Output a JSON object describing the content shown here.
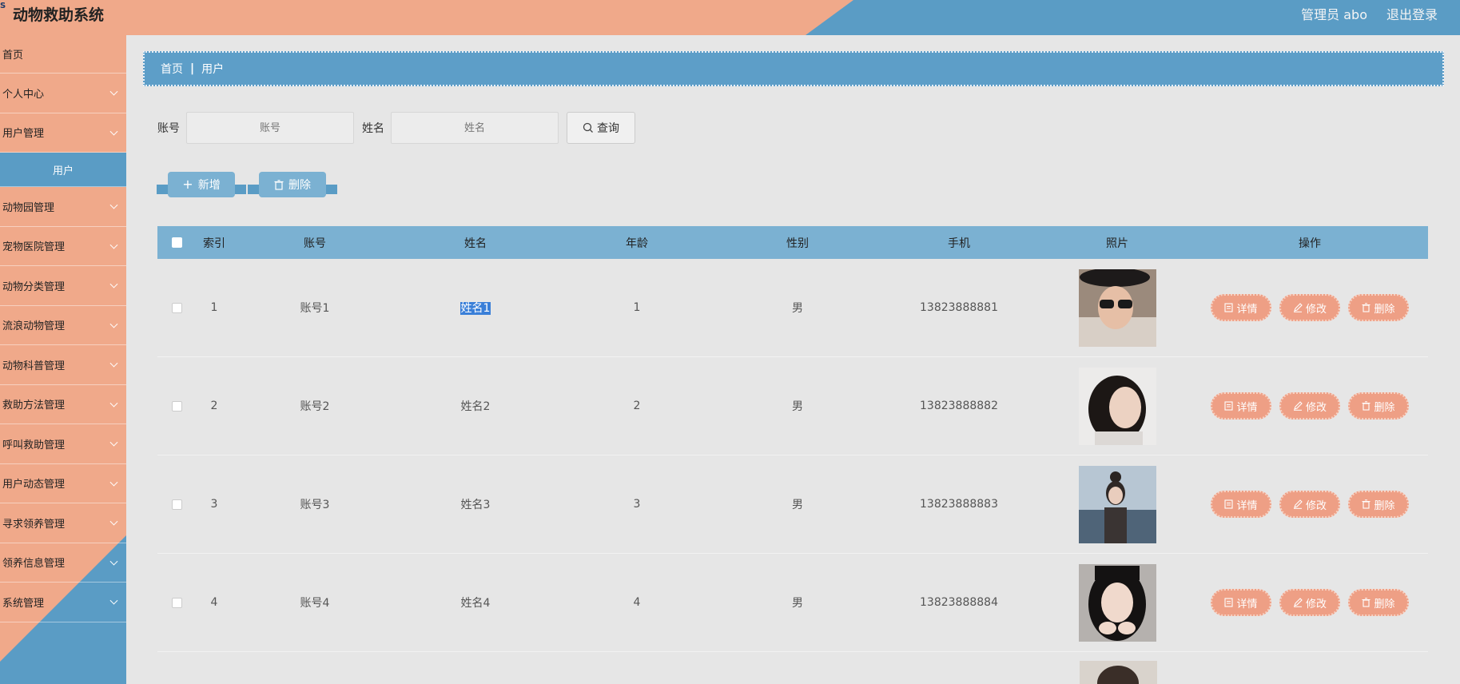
{
  "app": {
    "title": "动物救助系统"
  },
  "header": {
    "user": "管理员 abo",
    "logout": "退出登录"
  },
  "sidebar": {
    "items": [
      {
        "label": "首页",
        "expandable": false
      },
      {
        "label": "个人中心",
        "expandable": true
      },
      {
        "label": "用户管理",
        "expandable": true
      },
      {
        "label": "用户",
        "sub": true
      },
      {
        "label": "动物园管理",
        "expandable": true
      },
      {
        "label": "宠物医院管理",
        "expandable": true
      },
      {
        "label": "动物分类管理",
        "expandable": true
      },
      {
        "label": "流浪动物管理",
        "expandable": true
      },
      {
        "label": "动物科普管理",
        "expandable": true
      },
      {
        "label": "救助方法管理",
        "expandable": true
      },
      {
        "label": "呼叫救助管理",
        "expandable": true
      },
      {
        "label": "用户动态管理",
        "expandable": true
      },
      {
        "label": "寻求领养管理",
        "expandable": true
      },
      {
        "label": "领养信息管理",
        "expandable": true
      },
      {
        "label": "系统管理",
        "expandable": true
      }
    ]
  },
  "breadcrumb": {
    "home": "首页",
    "current": "用户"
  },
  "search": {
    "account_label": "账号",
    "account_placeholder": "账号",
    "name_label": "姓名",
    "name_placeholder": "姓名",
    "button": "查询"
  },
  "actions": {
    "add": "新增",
    "delete": "删除"
  },
  "table": {
    "headers": [
      "索引",
      "账号",
      "姓名",
      "年龄",
      "性别",
      "手机",
      "照片",
      "操作"
    ],
    "rows": [
      {
        "index": "1",
        "account": "账号1",
        "name": "姓名1",
        "age": "1",
        "sex": "男",
        "phone": "13823888881"
      },
      {
        "index": "2",
        "account": "账号2",
        "name": "姓名2",
        "age": "2",
        "sex": "男",
        "phone": "13823888882"
      },
      {
        "index": "3",
        "account": "账号3",
        "name": "姓名3",
        "age": "3",
        "sex": "男",
        "phone": "13823888883"
      },
      {
        "index": "4",
        "account": "账号4",
        "name": "姓名4",
        "age": "4",
        "sex": "男",
        "phone": "13823888884"
      }
    ],
    "ops": {
      "detail": "详情",
      "edit": "修改",
      "delete": "删除"
    }
  },
  "colors": {
    "accent_blue": "#5a9cc5",
    "accent_salmon": "#f0a98a",
    "header_blue": "#7bb1d2",
    "op_button": "#ee9f85"
  }
}
